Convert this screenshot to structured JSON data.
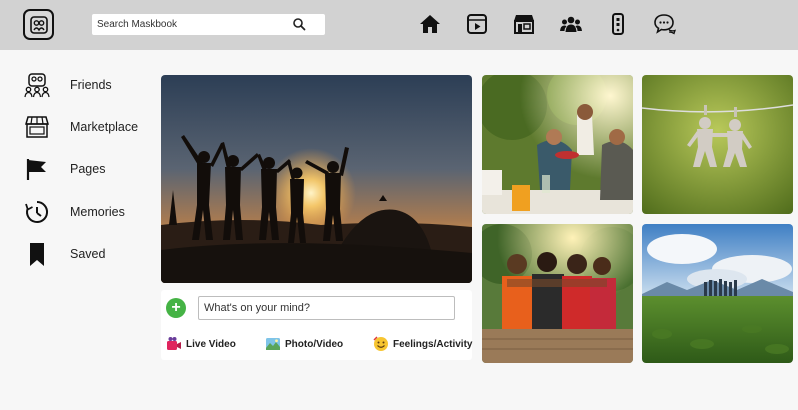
{
  "search": {
    "placeholder": "Search Maskbook"
  },
  "nav": [
    "home-icon",
    "video-icon",
    "marketplace-icon",
    "groups-icon",
    "gaming-icon",
    "messenger-icon"
  ],
  "sidebar": {
    "items": [
      {
        "label": "Friends",
        "icon": "friends-icon"
      },
      {
        "label": "Marketplace",
        "icon": "marketplace-icon"
      },
      {
        "label": "Pages",
        "icon": "flag-icon"
      },
      {
        "label": "Memories",
        "icon": "clock-icon"
      },
      {
        "label": "Saved",
        "icon": "bookmark-icon"
      }
    ]
  },
  "composer": {
    "placeholder": "What's on your mind?",
    "actions": [
      {
        "label": "Live Video",
        "icon": "live-video-icon"
      },
      {
        "label": "Photo/Video",
        "icon": "photo-icon"
      },
      {
        "label": "Feelings/Activity",
        "icon": "emoji-icon"
      }
    ]
  },
  "colors": {
    "topbar": "#d2d2d2",
    "background": "#f7f7f7",
    "add_button": "#45b345"
  }
}
